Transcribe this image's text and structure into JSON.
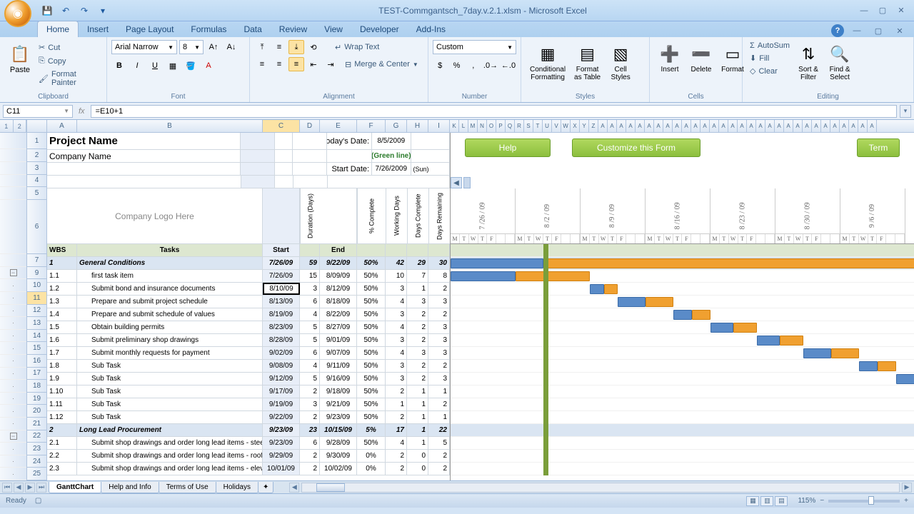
{
  "title": "TEST-Commgantsch_7day.v.2.1.xlsm - Microsoft Excel",
  "ribbon_tabs": [
    "Home",
    "Insert",
    "Page Layout",
    "Formulas",
    "Data",
    "Review",
    "View",
    "Developer",
    "Add-Ins"
  ],
  "active_tab": "Home",
  "clipboard": {
    "paste": "Paste",
    "cut": "Cut",
    "copy": "Copy",
    "fp": "Format Painter",
    "label": "Clipboard"
  },
  "font": {
    "name": "Arial Narrow",
    "size": "8",
    "label": "Font"
  },
  "alignment": {
    "wrap": "Wrap Text",
    "merge": "Merge & Center",
    "label": "Alignment"
  },
  "number": {
    "format": "Custom",
    "label": "Number"
  },
  "styles": {
    "cond": "Conditional\nFormatting",
    "fmt": "Format\nas Table",
    "cell": "Cell\nStyles",
    "label": "Styles"
  },
  "cellsg": {
    "ins": "Insert",
    "del": "Delete",
    "fmt": "Format",
    "label": "Cells"
  },
  "editing": {
    "sum": "AutoSum",
    "fill": "Fill",
    "clear": "Clear",
    "sort": "Sort &\nFilter",
    "find": "Find &\nSelect",
    "label": "Editing"
  },
  "name_box": "C11",
  "formula": "=E10+1",
  "cols": [
    "A",
    "B",
    "C",
    "D",
    "E",
    "F",
    "G",
    "H",
    "I",
    "K",
    "L",
    "M",
    "N",
    "O",
    "P",
    "Q",
    "R",
    "S",
    "T",
    "U",
    "V",
    "W",
    "X",
    "Y",
    "Z"
  ],
  "project_name": "Project Name",
  "company_name": "Company Name",
  "logo_text": "Company Logo Here",
  "today_label": "Today's Date:",
  "today_date": "8/5/2009",
  "green_line": "(Green line)",
  "start_label": "Start Date:",
  "start_date": "7/26/2009",
  "sun": "(Sun)",
  "help_btn": "Help",
  "customize_btn": "Customize this Form",
  "term_btn": "Term",
  "hdr": {
    "wbs": "WBS",
    "tasks": "Tasks",
    "start": "Start",
    "dur": "Duration (Days)",
    "end": "End",
    "pct": "% Complete",
    "wd": "Working Days",
    "dc": "Days Complete",
    "dr": "Days Remaining"
  },
  "rows": [
    {
      "n": 9,
      "wbs": "1",
      "task": "General Conditions",
      "start": "7/26/09",
      "dur": "59",
      "end": "9/22/09",
      "pct": "50%",
      "wd": "42",
      "dc": "29",
      "dr": "30",
      "sum": true
    },
    {
      "n": 10,
      "wbs": "1.1",
      "task": "first task item",
      "start": "7/26/09",
      "dur": "15",
      "end": "8/09/09",
      "pct": "50%",
      "wd": "10",
      "dc": "7",
      "dr": "8"
    },
    {
      "n": 11,
      "wbs": "1.2",
      "task": "Submit bond and insurance documents",
      "start": "8/10/09",
      "dur": "3",
      "end": "8/12/09",
      "pct": "50%",
      "wd": "3",
      "dc": "1",
      "dr": "2",
      "sel": true
    },
    {
      "n": 12,
      "wbs": "1.3",
      "task": "Prepare and submit project schedule",
      "start": "8/13/09",
      "dur": "6",
      "end": "8/18/09",
      "pct": "50%",
      "wd": "4",
      "dc": "3",
      "dr": "3"
    },
    {
      "n": 13,
      "wbs": "1.4",
      "task": "Prepare and submit schedule of values",
      "start": "8/19/09",
      "dur": "4",
      "end": "8/22/09",
      "pct": "50%",
      "wd": "3",
      "dc": "2",
      "dr": "2"
    },
    {
      "n": 14,
      "wbs": "1.5",
      "task": "Obtain building permits",
      "start": "8/23/09",
      "dur": "5",
      "end": "8/27/09",
      "pct": "50%",
      "wd": "4",
      "dc": "2",
      "dr": "3"
    },
    {
      "n": 15,
      "wbs": "1.6",
      "task": "Submit preliminary shop drawings",
      "start": "8/28/09",
      "dur": "5",
      "end": "9/01/09",
      "pct": "50%",
      "wd": "3",
      "dc": "2",
      "dr": "3"
    },
    {
      "n": 16,
      "wbs": "1.7",
      "task": "Submit monthly requests for payment",
      "start": "9/02/09",
      "dur": "6",
      "end": "9/07/09",
      "pct": "50%",
      "wd": "4",
      "dc": "3",
      "dr": "3"
    },
    {
      "n": 17,
      "wbs": "1.8",
      "task": "Sub Task",
      "start": "9/08/09",
      "dur": "4",
      "end": "9/11/09",
      "pct": "50%",
      "wd": "3",
      "dc": "2",
      "dr": "2"
    },
    {
      "n": 18,
      "wbs": "1.9",
      "task": "Sub Task",
      "start": "9/12/09",
      "dur": "5",
      "end": "9/16/09",
      "pct": "50%",
      "wd": "3",
      "dc": "2",
      "dr": "3"
    },
    {
      "n": 19,
      "wbs": "1.10",
      "task": "Sub Task",
      "start": "9/17/09",
      "dur": "2",
      "end": "9/18/09",
      "pct": "50%",
      "wd": "2",
      "dc": "1",
      "dr": "1"
    },
    {
      "n": 20,
      "wbs": "1.11",
      "task": "Sub Task",
      "start": "9/19/09",
      "dur": "3",
      "end": "9/21/09",
      "pct": "50%",
      "wd": "1",
      "dc": "1",
      "dr": "2"
    },
    {
      "n": 21,
      "wbs": "1.12",
      "task": "Sub Task",
      "start": "9/22/09",
      "dur": "2",
      "end": "9/23/09",
      "pct": "50%",
      "wd": "2",
      "dc": "1",
      "dr": "1"
    },
    {
      "n": 22,
      "wbs": "2",
      "task": "Long Lead Procurement",
      "start": "9/23/09",
      "dur": "23",
      "end": "10/15/09",
      "pct": "5%",
      "wd": "17",
      "dc": "1",
      "dr": "22",
      "sum": true
    },
    {
      "n": 23,
      "wbs": "2.1",
      "task": "Submit shop drawings and order long lead items - steel",
      "start": "9/23/09",
      "dur": "6",
      "end": "9/28/09",
      "pct": "50%",
      "wd": "4",
      "dc": "1",
      "dr": "5"
    },
    {
      "n": 24,
      "wbs": "2.2",
      "task": "Submit shop drawings and order long lead items - roofing",
      "start": "9/29/09",
      "dur": "2",
      "end": "9/30/09",
      "pct": "0%",
      "wd": "2",
      "dc": "0",
      "dr": "2"
    },
    {
      "n": 25,
      "wbs": "2.3",
      "task": "Submit shop drawings and order long lead items - elevator",
      "start": "10/01/09",
      "dur": "2",
      "end": "10/02/09",
      "pct": "0%",
      "wd": "2",
      "dc": "0",
      "dr": "2"
    }
  ],
  "weeks": [
    "7 /26 / 09",
    "8 /2 / 09",
    "8 /9 / 09",
    "8 /16 / 09",
    "8 /23 / 09",
    "8 /30 / 09",
    "9 /6 / 09"
  ],
  "day_labels": [
    "M",
    "T",
    "W",
    "T",
    "F",
    " ",
    " "
  ],
  "bars": [
    {
      "r": 0,
      "l": 0,
      "wb": 130,
      "wo": 570
    },
    {
      "r": 1,
      "l": 0,
      "wb": 91,
      "wo": 104
    },
    {
      "r": 2,
      "l": 195,
      "wb": 20,
      "wo": 19
    },
    {
      "r": 3,
      "l": 234,
      "wb": 39,
      "wo": 39
    },
    {
      "r": 4,
      "l": 312,
      "wb": 26,
      "wo": 26
    },
    {
      "r": 5,
      "l": 364,
      "wb": 32,
      "wo": 33
    },
    {
      "r": 6,
      "l": 429,
      "wb": 32,
      "wo": 33
    },
    {
      "r": 7,
      "l": 494,
      "wb": 39,
      "wo": 39
    },
    {
      "r": 8,
      "l": 572,
      "wb": 26,
      "wo": 26
    },
    {
      "r": 9,
      "l": 624,
      "wb": 32,
      "wo": 10
    }
  ],
  "sheet_tabs": [
    "GanttChart",
    "Help and Info",
    "Terms of Use",
    "Holidays"
  ],
  "status": "Ready",
  "zoom": "115%"
}
